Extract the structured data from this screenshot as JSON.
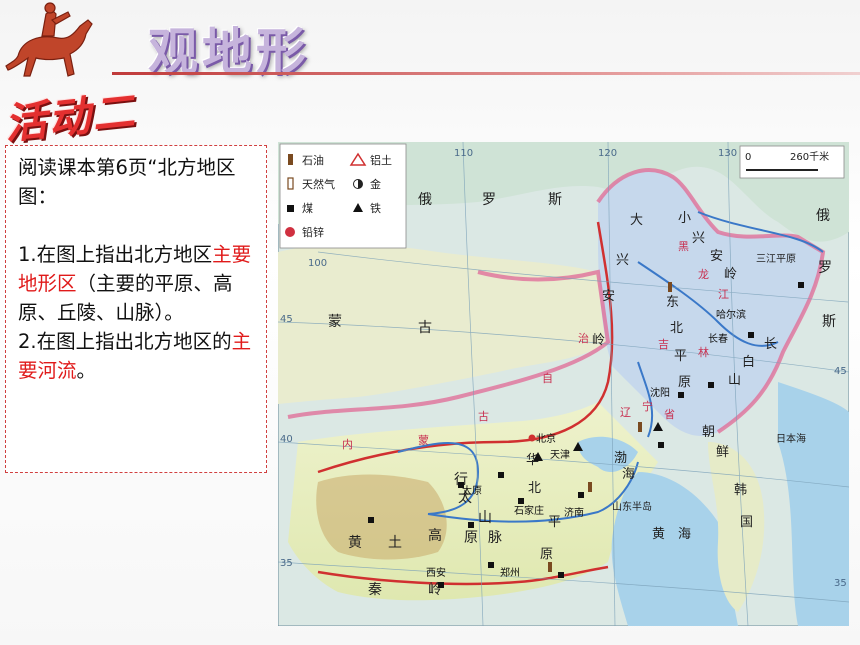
{
  "slide": {
    "title": "观地形",
    "activity": "活动二"
  },
  "instructions": {
    "line1": "阅读课本第6页“北方地区图：",
    "q1_prefix": "1.在图上指出北方地区",
    "q1_highlight": "主要地形区",
    "q1_suffix": "（主要的平原、高原、丘陵、山脉）。",
    "q2_prefix": "2.在图上指出北方地区的",
    "q2_highlight": "主要河流",
    "q2_suffix": "。"
  },
  "map": {
    "legend": {
      "oil": "石油",
      "bauxite": "铝土",
      "gas": "天然气",
      "gold": "金",
      "coal": "煤",
      "iron": "铁",
      "leadzinc": "铅锌"
    },
    "scale": {
      "zero": "0",
      "label": "260千米"
    },
    "longitudes": [
      "110",
      "120",
      "130",
      "100"
    ],
    "latitudes": [
      "45",
      "45",
      "40",
      "35",
      "35"
    ],
    "labels": {
      "russia": [
        "俄",
        "罗",
        "斯"
      ],
      "russia_east": [
        "俄",
        "罗",
        "斯"
      ],
      "mongolia": [
        "蒙",
        "古"
      ],
      "da_xing_an": [
        "大",
        "兴",
        "安",
        "岭"
      ],
      "xiao_xing_an": [
        "小",
        "兴",
        "安",
        "岭"
      ],
      "heilongjiang": [
        "黑",
        "龙",
        "江"
      ],
      "jilin": [
        "吉",
        "林"
      ],
      "liaoning": [
        "辽",
        "宁",
        "省"
      ],
      "neimenggu": [
        "内",
        "蒙",
        "古",
        "自",
        "治"
      ],
      "dongbei_pingyuan": [
        "东",
        "北",
        "平",
        "原"
      ],
      "changbai": [
        "长",
        "白",
        "山"
      ],
      "huabei_pingyuan": [
        "华",
        "北",
        "平",
        "原"
      ],
      "taihang": [
        "太",
        "行",
        "山",
        "脉"
      ],
      "huangtu": [
        "黄",
        "土",
        "高",
        "原"
      ],
      "qinling": [
        "秦",
        "岭"
      ],
      "shandong": "山东半岛",
      "bohai": [
        "渤",
        "海"
      ],
      "huanghai": [
        "黄",
        "海"
      ],
      "riben_hai": "日本海",
      "chaoxian": [
        "朝",
        "鲜"
      ],
      "hanguo": [
        "韩",
        "国"
      ],
      "sanjiang": "三江平原",
      "cities": {
        "beijing": "北京",
        "tianjin": "天津",
        "shenyang": "沈阳",
        "changchun": "长春",
        "harbin": "哈尔滨",
        "taiyuan": "太原",
        "shijiazhuang": "石家庄",
        "jinan": "济南",
        "zhengzhou": "郑州",
        "xian": "西安"
      }
    }
  },
  "colors": {
    "title_fill": "#c6b4dc",
    "activity": "#e43030",
    "highlight": "#e01a1a",
    "region_border": "#e0709a"
  },
  "icons": [
    "horse-rider-icon"
  ]
}
